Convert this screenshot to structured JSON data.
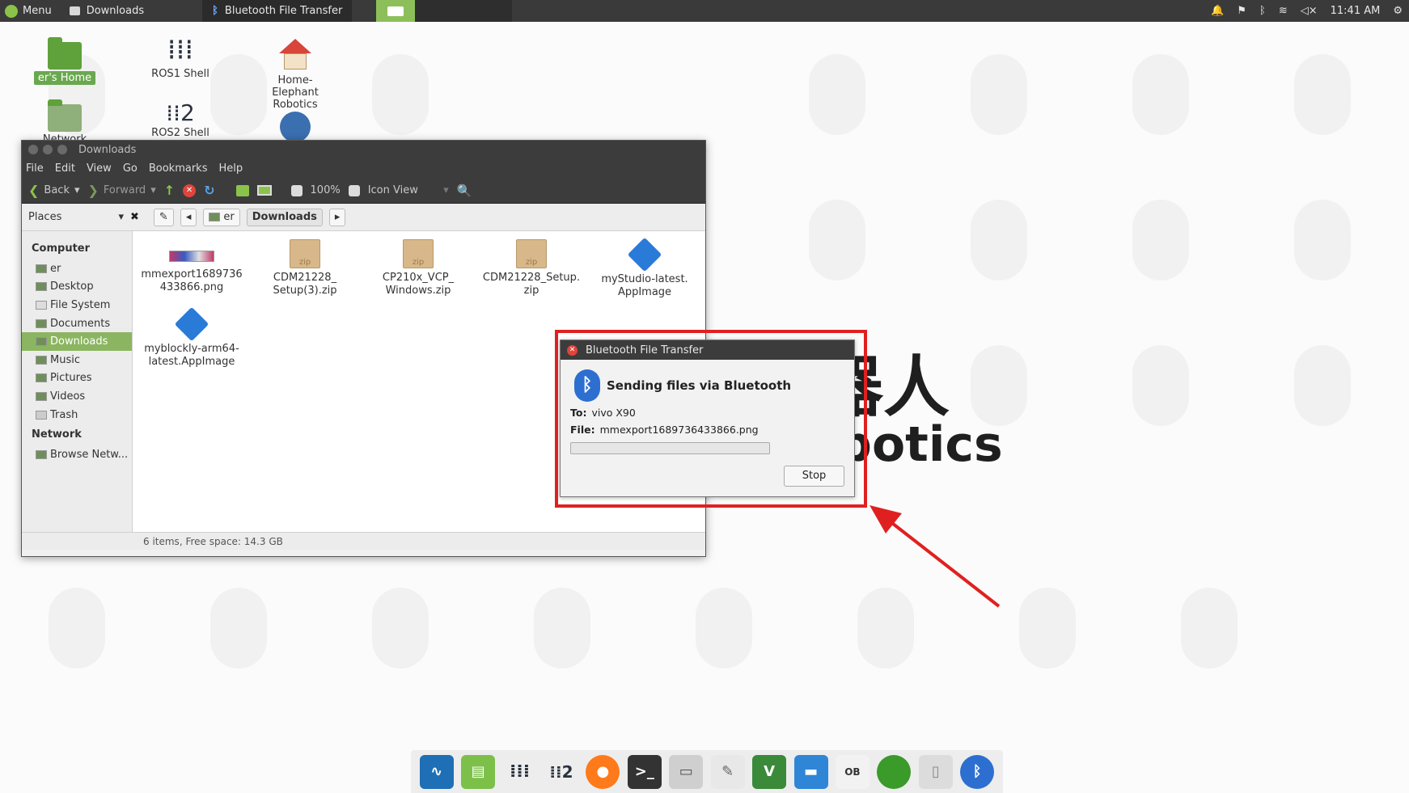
{
  "panel": {
    "menu_label": "Menu",
    "tasks": [
      {
        "label": "Downloads"
      },
      {
        "label": "Bluetooth File Transfer"
      }
    ],
    "clock": "11:41 AM"
  },
  "desktop": {
    "icons": [
      {
        "label": "er's Home"
      },
      {
        "label": "ROS1 Shell"
      },
      {
        "label": "Home-Elephant Robotics"
      },
      {
        "label": "Network Servers"
      },
      {
        "label": "ROS2 Shell"
      }
    ],
    "wallpaper_text": {
      "line1": "器人",
      "line2": "botics"
    }
  },
  "file_manager": {
    "title": "Downloads",
    "menus": [
      "File",
      "Edit",
      "View",
      "Go",
      "Bookmarks",
      "Help"
    ],
    "toolbar": {
      "back": "Back",
      "forward": "Forward",
      "zoom": "100%",
      "view_mode": "Icon View"
    },
    "places_label": "Places",
    "breadcrumb": {
      "home": "er",
      "current": "Downloads"
    },
    "sidebar": {
      "computer_heading": "Computer",
      "computer_items": [
        "er",
        "Desktop",
        "File System",
        "Documents",
        "Downloads",
        "Music",
        "Pictures",
        "Videos",
        "Trash"
      ],
      "network_heading": "Network",
      "network_items": [
        "Browse Netw..."
      ]
    },
    "files": [
      {
        "name_line1": "mmexport1689736",
        "name_line2": "433866.png"
      },
      {
        "name_line1": "CDM21228_",
        "name_line2": "Setup(3).zip"
      },
      {
        "name_line1": "CP210x_VCP_",
        "name_line2": "Windows.zip"
      },
      {
        "name_line1": "CDM21228_Setup.",
        "name_line2": "zip"
      },
      {
        "name_line1": "myStudio-latest.",
        "name_line2": "AppImage"
      },
      {
        "name_line1": "myblockly-arm64-",
        "name_line2": "latest.AppImage"
      }
    ],
    "zip_tag": "zip",
    "status": "6 items, Free space: 14.3 GB"
  },
  "bluetooth_dialog": {
    "title": "Bluetooth File Transfer",
    "heading": "Sending files via Bluetooth",
    "to_label": "To:",
    "to_value": "vivo X90",
    "file_label": "File:",
    "file_value": "mmexport1689736433866.png",
    "progress": 0,
    "stop_label": "Stop"
  },
  "colors": {
    "accent": "#8bc34a",
    "highlight": "#e02020"
  }
}
